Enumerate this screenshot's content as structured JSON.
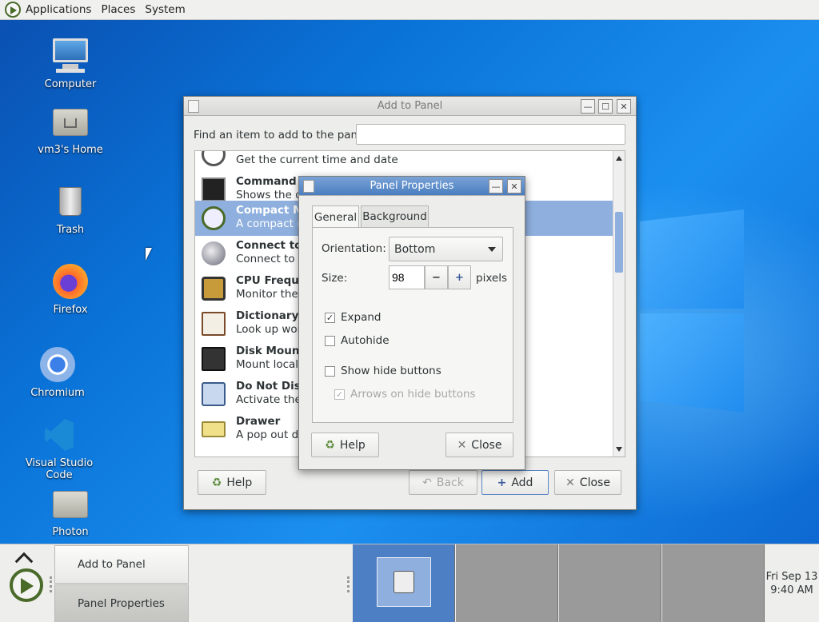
{
  "top_panel": {
    "menus": [
      "Applications",
      "Places",
      "System"
    ]
  },
  "desktop_icons": [
    {
      "label": "Computer",
      "icon": "computer-icon"
    },
    {
      "label": "vm3's Home",
      "icon": "home-folder-icon"
    },
    {
      "label": "Trash",
      "icon": "trash-icon"
    },
    {
      "label": "Firefox",
      "icon": "firefox-icon"
    },
    {
      "label": "Chromium",
      "icon": "chromium-icon"
    },
    {
      "label": "Visual Studio Code",
      "icon": "vscode-icon"
    },
    {
      "label": "Photon",
      "icon": "folder-icon"
    }
  ],
  "add_to_panel": {
    "title": "Add to Panel",
    "find_label": "Find an item to add to the panel:",
    "search_value": "",
    "items": [
      {
        "name": "",
        "desc": "Get the current time and date"
      },
      {
        "name": "Command",
        "desc": "Shows the ou"
      },
      {
        "name": "Compact Me",
        "desc": "A compact m"
      },
      {
        "name": "Connect to S",
        "desc": "Connect to a"
      },
      {
        "name": "CPU Frequen",
        "desc": "Monitor the C"
      },
      {
        "name": "Dictionary Lo",
        "desc": "Look up word"
      },
      {
        "name": "Disk Mounte",
        "desc": "Mount local d"
      },
      {
        "name": "Do Not Distu",
        "desc": "Activate the d"
      },
      {
        "name": "Drawer",
        "desc": "A pop out dra"
      }
    ],
    "help_label": "Help",
    "back_label": "Back",
    "add_label": "Add",
    "close_label": "Close"
  },
  "panel_properties": {
    "title": "Panel Properties",
    "tabs": [
      "General",
      "Background"
    ],
    "orientation_label": "Orientation:",
    "orientation_value": "Bottom",
    "size_label": "Size:",
    "size_value": "98",
    "size_unit": "pixels",
    "expand_label": "Expand",
    "autohide_label": "Autohide",
    "show_hide_label": "Show hide buttons",
    "arrows_label": "Arrows on hide buttons",
    "help_label": "Help",
    "close_label": "Close"
  },
  "bottom_panel": {
    "tasks": [
      "Add to Panel",
      "Panel Properties"
    ],
    "clock_date": "Fri Sep 13",
    "clock_time": "9:40 AM"
  },
  "colors": {
    "accent": "#4a7ec0",
    "selection": "#8fb0de",
    "desktop": "#0a73d8"
  }
}
